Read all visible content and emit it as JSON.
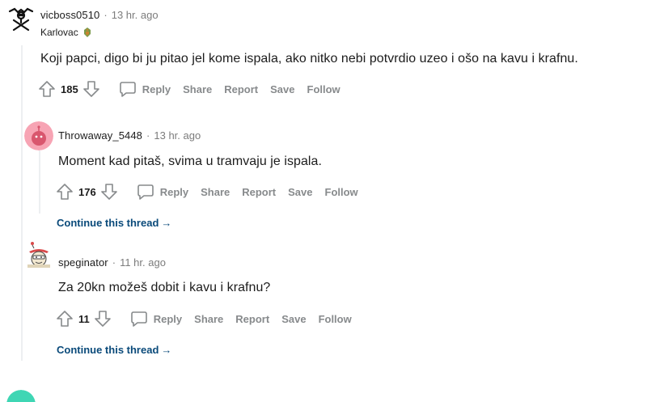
{
  "comments": [
    {
      "username": "vicboss0510",
      "separator": "·",
      "time": "13 hr. ago",
      "flair": "Karlovac",
      "body": "Koji papci, digo bi ju pitao jel kome ispala, ako nitko nebi potvrdio uzeo i ošo na kavu i krafnu.",
      "score": "185",
      "reply": "Reply",
      "share": "Share",
      "report": "Report",
      "save": "Save",
      "follow": "Follow"
    },
    {
      "username": "Throwaway_5448",
      "separator": "·",
      "time": "13 hr. ago",
      "body": "Moment kad pitaš, svima u tramvaju je ispala.",
      "score": "176",
      "reply": "Reply",
      "share": "Share",
      "report": "Report",
      "save": "Save",
      "follow": "Follow",
      "continue": "Continue this thread"
    },
    {
      "username": "speginator",
      "separator": "·",
      "time": "11 hr. ago",
      "body": "Za 20kn možeš dobit i kavu i krafnu?",
      "score": "11",
      "reply": "Reply",
      "share": "Share",
      "report": "Report",
      "save": "Save",
      "follow": "Follow",
      "continue": "Continue this thread"
    }
  ],
  "colors": {
    "muted": "#878a8c",
    "link": "#0a4a7a",
    "thread_line": "#edeff1"
  }
}
